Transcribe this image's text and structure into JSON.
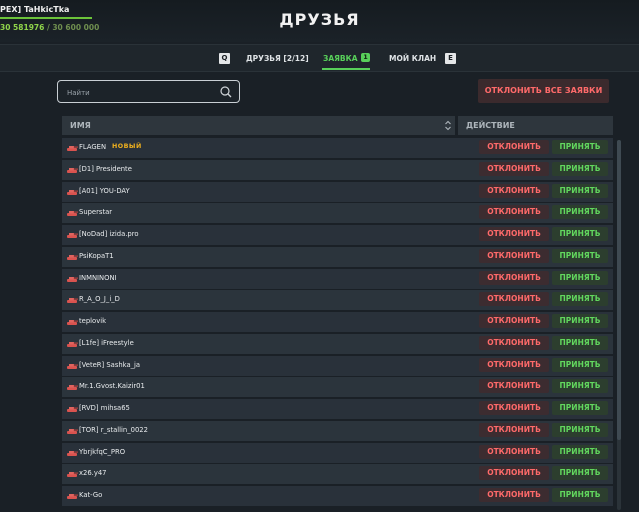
{
  "player": {
    "name": "PEX] TaHkicTka",
    "xp_current": "30 581976",
    "xp_separator": " / ",
    "xp_max": "30 600 000",
    "xp_progress": 0.9994
  },
  "header": {
    "title": "ДРУЗЬЯ"
  },
  "tabs": {
    "left_key": "Q",
    "right_key": "E",
    "items": [
      {
        "label": "ДРУЗЬЯ [2/12]"
      },
      {
        "label": "ЗАЯВКА",
        "badge": "1",
        "active": true
      },
      {
        "label": "МОЙ КЛАН"
      }
    ]
  },
  "search": {
    "placeholder": "Найти",
    "value": ""
  },
  "decline_all_label": "ОТКЛОНИТЬ ВСЕ ЗАЯВКИ",
  "table": {
    "col_name": "ИМЯ",
    "col_action": "ДЕЙСТВИЕ",
    "decline_label": "ОТКЛОНИТЬ",
    "accept_label": "ПРИНЯТЬ",
    "new_badge": "НОВЫЙ",
    "rows": [
      {
        "name": "FLAGEN",
        "is_new": true
      },
      {
        "name": "[D1] Presidente"
      },
      {
        "name": "[A01] YOU-DAY"
      },
      {
        "name": "Superstar"
      },
      {
        "name": "[NoDad] izida.pro"
      },
      {
        "name": "PsiKopaT1"
      },
      {
        "name": "INMNINONI"
      },
      {
        "name": "R_A_O_J_i_D"
      },
      {
        "name": "teplovik"
      },
      {
        "name": "[L1fe] iFreestyle"
      },
      {
        "name": "[VeteR] Sashka_ja"
      },
      {
        "name": "Mr.1.Gvost.Kaizir01"
      },
      {
        "name": "[RVD] mihsa65"
      },
      {
        "name": "[TOR] r_stallin_0022"
      },
      {
        "name": "YbrjkfqC_PRO"
      },
      {
        "name": "x26.y47"
      },
      {
        "name": "Kat-Go"
      }
    ]
  },
  "colors": {
    "accent_green": "#58d05a",
    "decline_red": "#ff6a6a",
    "new_badge": "#f2b21d",
    "background": "#1a2026"
  },
  "icons": {
    "search": "search-icon",
    "sort": "sort-icon",
    "tank": "tank-icon"
  }
}
